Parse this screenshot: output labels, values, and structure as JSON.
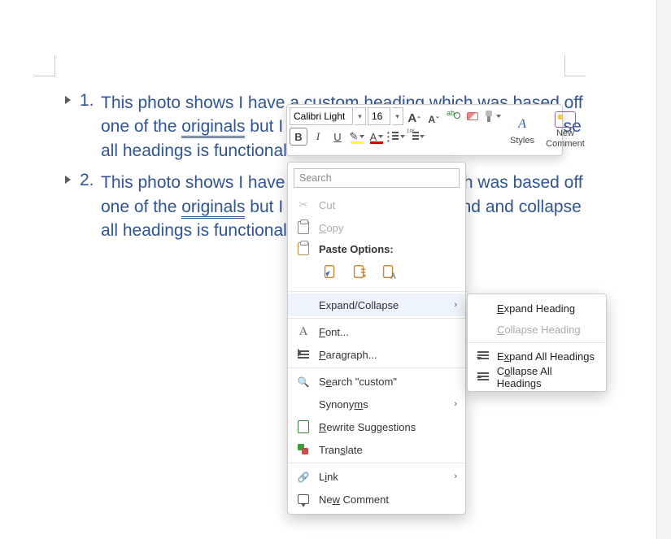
{
  "document": {
    "headings": [
      {
        "number": "1.",
        "text_before": "This photo shows I have a custom heading which was based off one of the ",
        "underlined": "originals",
        "text_after": " but I forgot which one. Expand and collapse all headings is functional when"
      },
      {
        "number": "2.",
        "text_before": "This photo shows I have a custom heading which was based off one of the ",
        "underlined": "originals",
        "text_after": " but I forgot which one. Expand and collapse all headings is functional when"
      }
    ]
  },
  "mini_toolbar": {
    "font_name": "Calibri Light",
    "font_size": "16",
    "grow": "A",
    "grow_sup": "ˆ",
    "shrink": "A",
    "shrink_sup": "ˇ",
    "bold": "B",
    "italic": "I",
    "underline": "U",
    "font_color_letter": "A",
    "styles_label": "Styles",
    "new_comment_label": "New Comment"
  },
  "context_menu": {
    "search_placeholder": "Search",
    "cut": "Cut",
    "copy": "Copy",
    "paste_header": "Paste Options:",
    "expand_collapse": "Expand/Collapse",
    "font": "Font...",
    "paragraph": "Paragraph...",
    "search_custom": "Search \"custom\"",
    "synonyms": "Synonyms",
    "rewrite": "Rewrite Suggestions",
    "translate": "Translate",
    "link": "Link",
    "new_comment": "New Comment"
  },
  "submenu": {
    "expand_heading": "Expand Heading",
    "collapse_heading": "Collapse Heading",
    "expand_all": "Expand All Headings",
    "collapse_all": "Collapse All Headings"
  }
}
